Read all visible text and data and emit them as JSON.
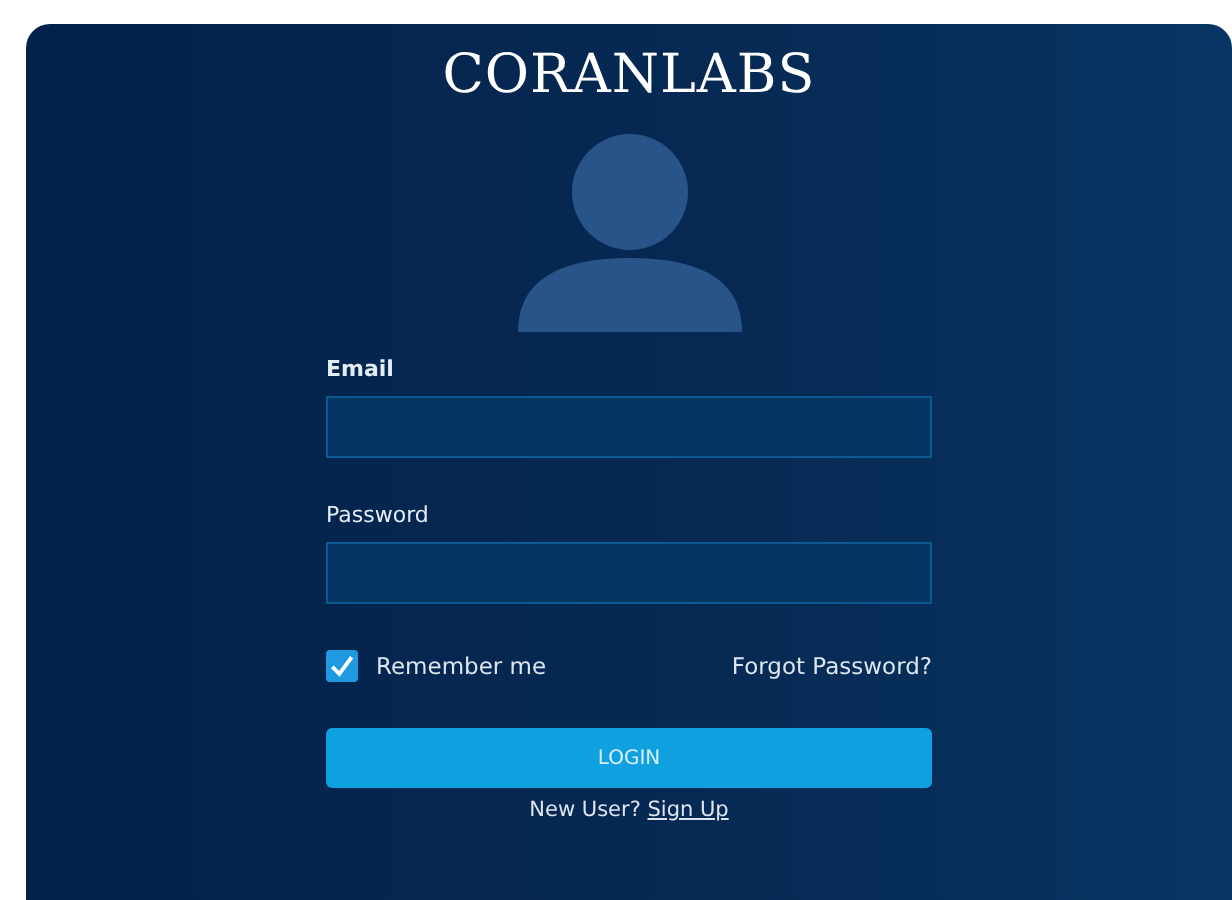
{
  "brand": "CORANLABS",
  "fields": [
    {
      "label": "Email",
      "bold": true
    },
    {
      "label": "Password",
      "bold": false
    }
  ],
  "remember": {
    "label": "Remember me",
    "checked": true
  },
  "forgot_link": "Forgot Password?",
  "login_button": "LOGIN",
  "signup": {
    "prompt": "New User?",
    "link": "Sign Up"
  }
}
